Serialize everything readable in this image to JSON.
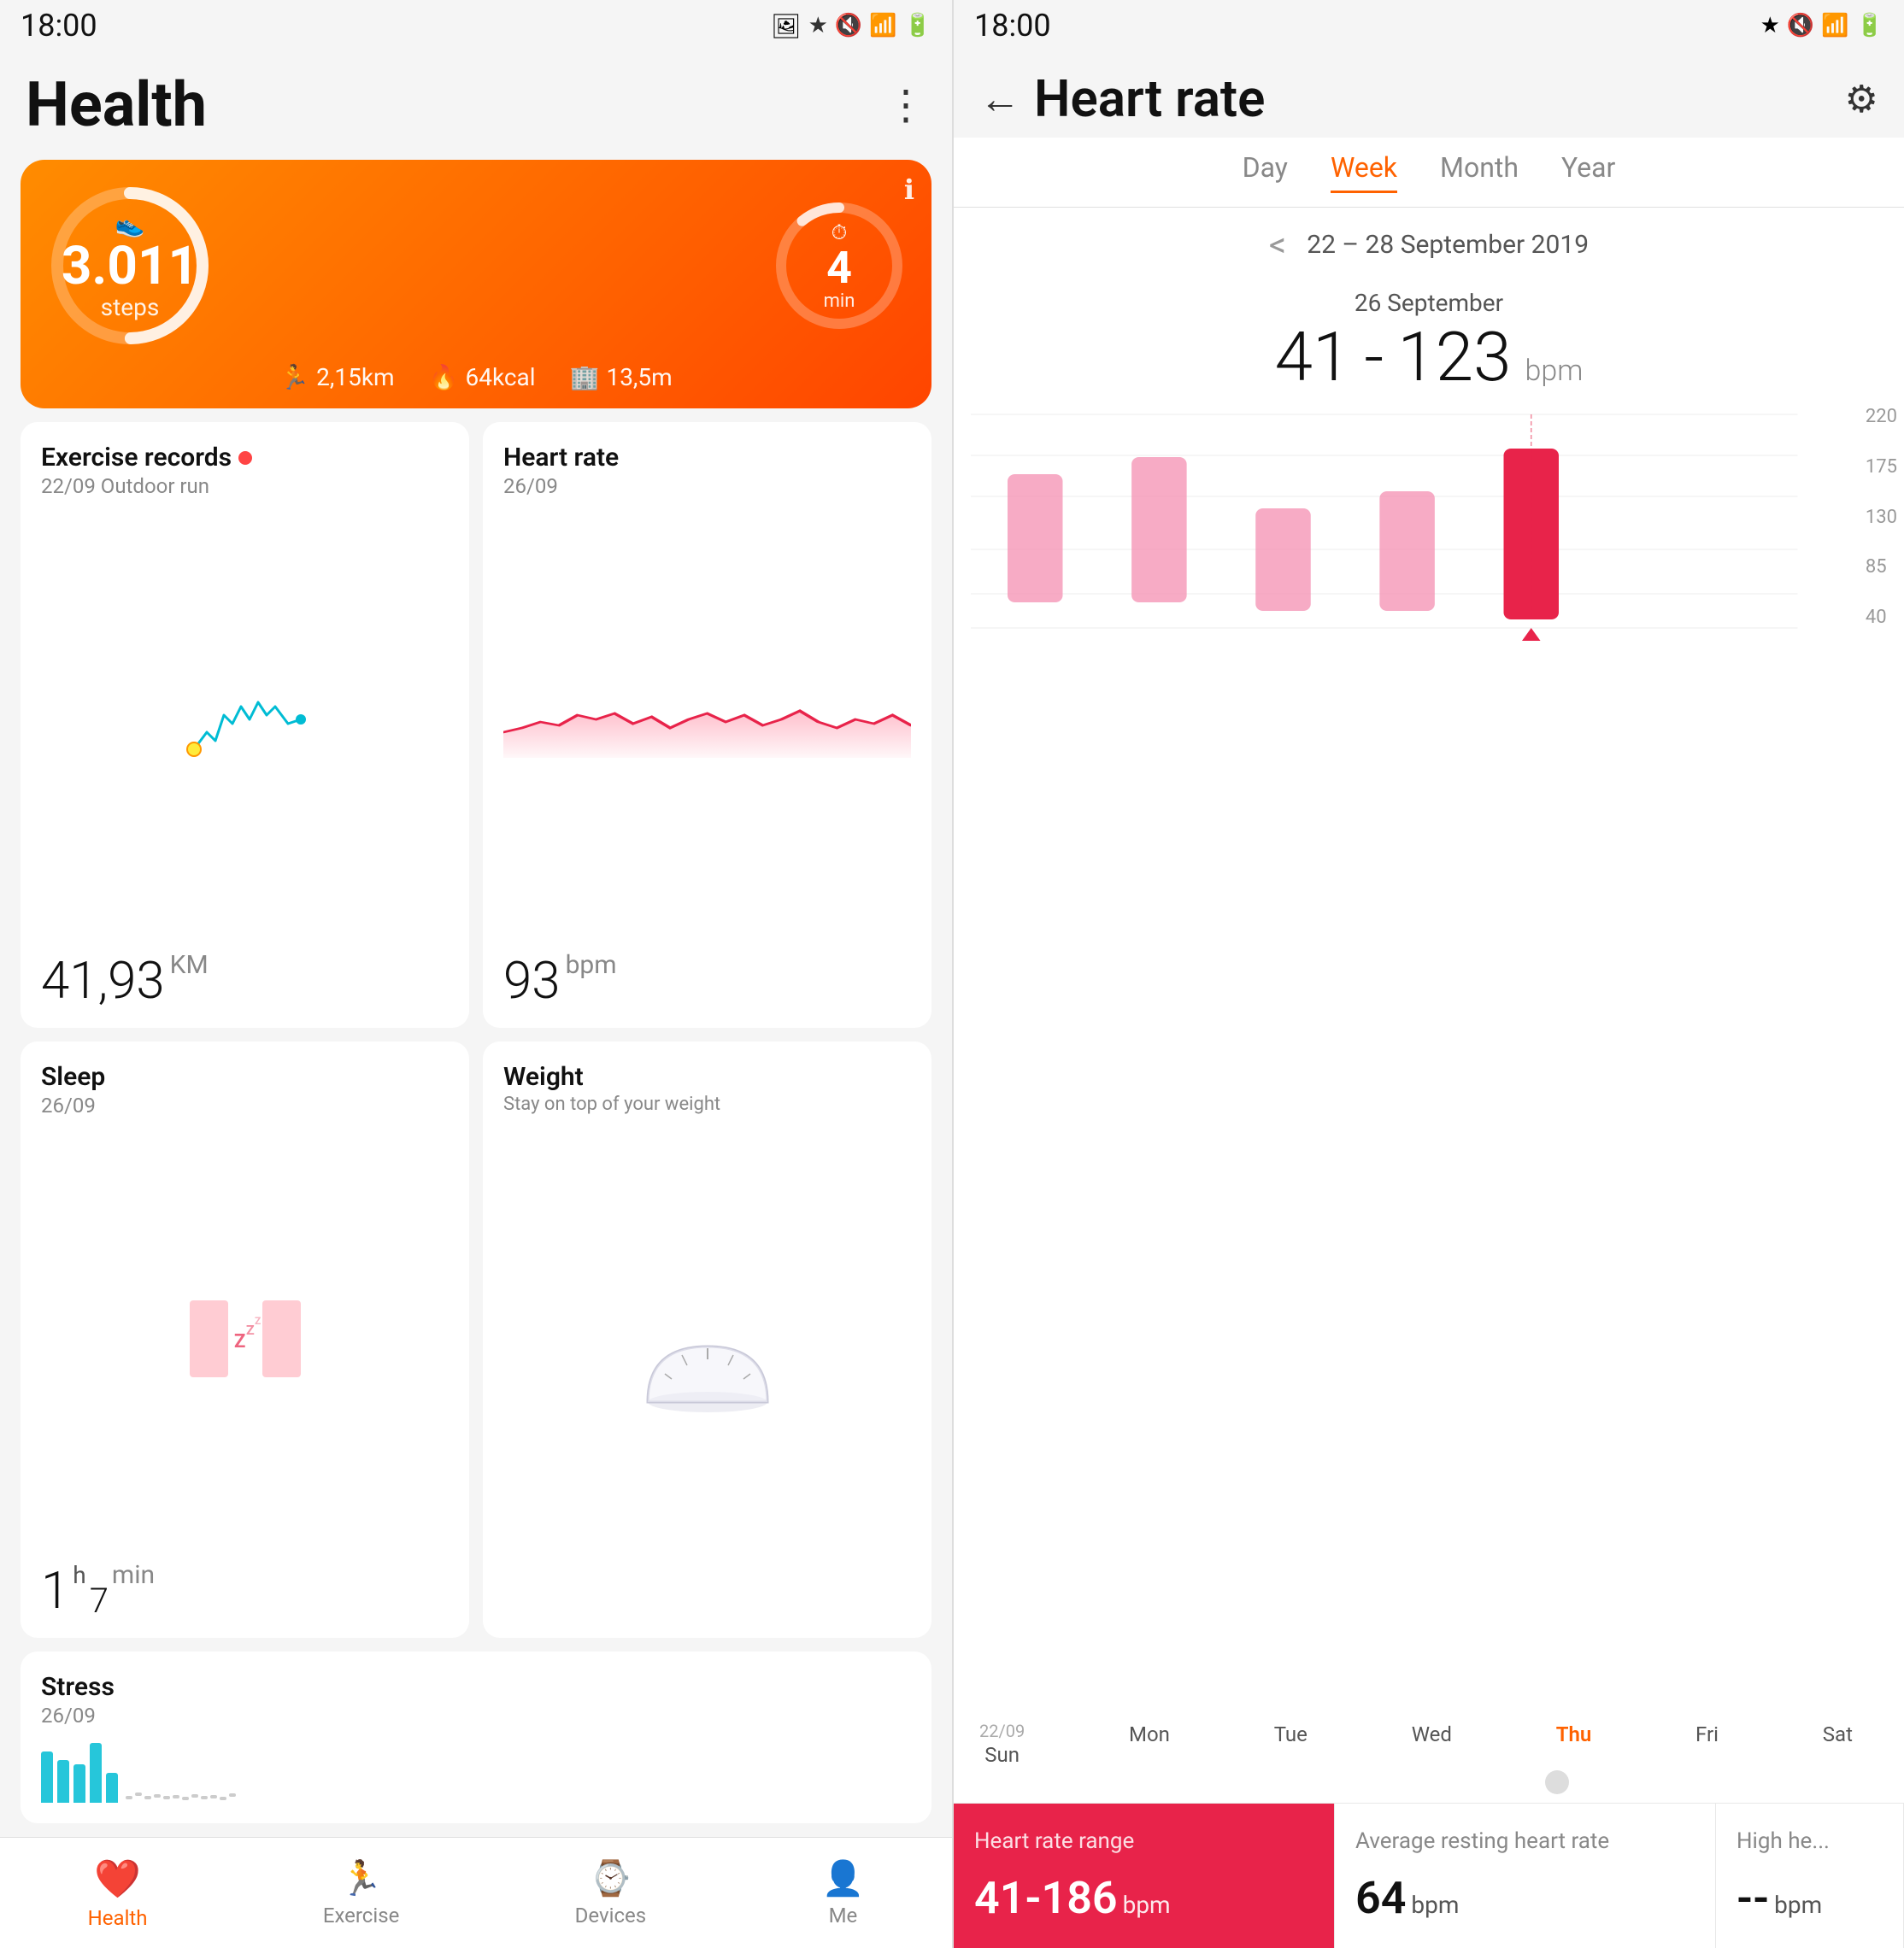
{
  "left": {
    "status": {
      "time": "18:00",
      "icons": [
        "bluetooth",
        "mute",
        "wifi",
        "signal",
        "battery"
      ]
    },
    "header": {
      "title": "Health",
      "menu": "⋮"
    },
    "hero": {
      "steps_value": "3.011",
      "steps_unit": "steps",
      "timer_value": "4",
      "timer_unit": "min",
      "distance": "2,15km",
      "calories": "64kcal",
      "floors": "13,5m",
      "info_icon": "ℹ"
    },
    "exercise_card": {
      "title": "Exercise records",
      "subtitle": "22/09 Outdoor run",
      "value": "41,93",
      "unit": "KM"
    },
    "heartrate_card": {
      "title": "Heart rate",
      "subtitle": "26/09",
      "value": "93",
      "unit": "bpm"
    },
    "sleep_card": {
      "title": "Sleep",
      "subtitle": "26/09",
      "value_h": "1",
      "value_m": "7",
      "unit": "min"
    },
    "weight_card": {
      "title": "Weight",
      "subtitle": "Stay on top of your weight"
    },
    "stress_card": {
      "title": "Stress",
      "subtitle": "26/09"
    },
    "nav": {
      "items": [
        {
          "label": "Health",
          "active": true
        },
        {
          "label": "Exercise",
          "active": false
        },
        {
          "label": "Devices",
          "active": false
        },
        {
          "label": "Me",
          "active": false
        }
      ]
    }
  },
  "right": {
    "status": {
      "time": "18:00"
    },
    "header": {
      "title": "Heart rate",
      "back": "←",
      "settings": "⚙"
    },
    "tabs": [
      {
        "label": "Day",
        "active": false
      },
      {
        "label": "Week",
        "active": true
      },
      {
        "label": "Month",
        "active": false
      },
      {
        "label": "Year",
        "active": false
      }
    ],
    "date_range": "22 – 28 September 2019",
    "selected_date": "26 September",
    "bpm_low": "41",
    "bpm_dash": "-",
    "bpm_high": "123",
    "bpm_unit": "bpm",
    "chart": {
      "y_labels": [
        "220",
        "175",
        "130",
        "85",
        "40"
      ],
      "bars": [
        {
          "date": "22/09",
          "day": "Sun",
          "height_pct": 55,
          "selected": false
        },
        {
          "date": "",
          "day": "Mon",
          "height_pct": 62,
          "selected": false
        },
        {
          "date": "",
          "day": "Tue",
          "height_pct": 40,
          "selected": false
        },
        {
          "date": "",
          "day": "Wed",
          "height_pct": 48,
          "selected": false
        },
        {
          "date": "",
          "day": "Thu",
          "height_pct": 70,
          "selected": true
        },
        {
          "date": "",
          "day": "Fri",
          "height_pct": 0,
          "selected": false
        },
        {
          "date": "",
          "day": "Sat",
          "height_pct": 0,
          "selected": false
        }
      ]
    },
    "info_cards": [
      {
        "label": "Heart rate range",
        "value": "41-186",
        "unit": "bpm",
        "highlight": true
      },
      {
        "label": "Average resting heart rate",
        "value": "64",
        "unit": "bpm",
        "highlight": false
      },
      {
        "label": "High heart rate",
        "value": "--",
        "unit": "bpm",
        "highlight": false
      }
    ]
  }
}
